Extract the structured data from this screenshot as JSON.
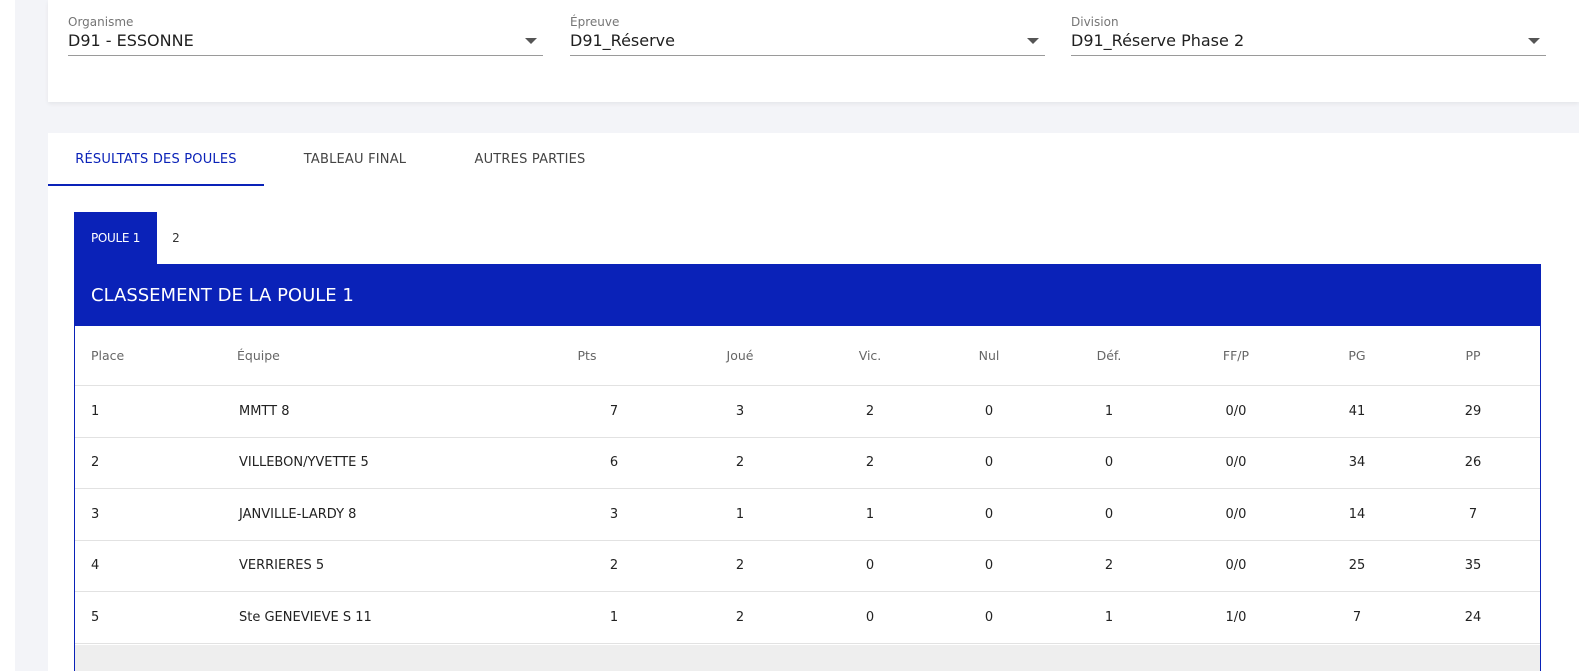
{
  "filters": {
    "organisme": {
      "label": "Organisme",
      "value": "D91 - ESSONNE"
    },
    "epreuve": {
      "label": "Épreuve",
      "value": "D91_Réserve"
    },
    "division": {
      "label": "Division",
      "value": "D91_Réserve Phase 2"
    }
  },
  "tabs": [
    {
      "label": "RÉSULTATS DES POULES",
      "active": true
    },
    {
      "label": "TABLEAU FINAL",
      "active": false
    },
    {
      "label": "AUTRES PARTIES",
      "active": false
    }
  ],
  "poule_tabs": [
    {
      "label": "POULE 1",
      "active": true
    },
    {
      "label": "2",
      "active": false
    }
  ],
  "ranking": {
    "title": "CLASSEMENT DE LA POULE 1",
    "columns": [
      "Place",
      "Équipe",
      "Pts",
      "Joué",
      "Vic.",
      "Nul",
      "Déf.",
      "FF/P",
      "PG",
      "PP"
    ],
    "rows": [
      [
        "1",
        "MMTT 8",
        "7",
        "3",
        "2",
        "0",
        "1",
        "0/0",
        "41",
        "29"
      ],
      [
        "2",
        "VILLEBON/YVETTE 5",
        "6",
        "2",
        "2",
        "0",
        "0",
        "0/0",
        "34",
        "26"
      ],
      [
        "3",
        "JANVILLE-LARDY 8",
        "3",
        "1",
        "1",
        "0",
        "0",
        "0/0",
        "14",
        "7"
      ],
      [
        "4",
        "VERRIERES 5",
        "2",
        "2",
        "0",
        "0",
        "2",
        "0/0",
        "25",
        "35"
      ],
      [
        "5",
        "Ste GENEVIEVE S 11",
        "1",
        "2",
        "0",
        "0",
        "1",
        "1/0",
        "7",
        "24"
      ]
    ]
  },
  "colors": {
    "accent": "#0a22b8",
    "background": "#f3f4f8"
  }
}
